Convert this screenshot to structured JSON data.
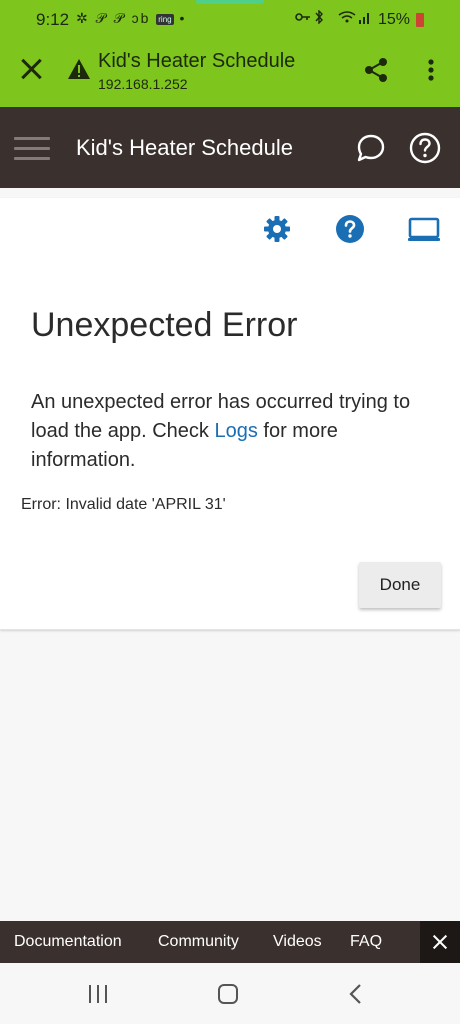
{
  "status_bar": {
    "time": "9:12",
    "notifications": "✲ 𝒫 𝒫 ↄb",
    "ring_badge": "ring",
    "dot": "•",
    "battery": "15%"
  },
  "browser": {
    "title": "Kid's Heater Schedule",
    "url": "192.168.1.252"
  },
  "app": {
    "title": "Kid's Heater Schedule"
  },
  "toolbar_icons": [
    "gear-icon",
    "help-icon",
    "laptop-icon"
  ],
  "error": {
    "title": "Unexpected Error",
    "message_before": "An unexpected error has occurred trying to load the app. Check ",
    "link": "Logs",
    "message_after": " for more information.",
    "detail": "Error: Invalid date 'APRIL 31'",
    "done_label": "Done"
  },
  "bottom_links": [
    "Documentation",
    "Community",
    "Videos",
    "FAQ"
  ],
  "colors": {
    "status_green": "#7ec51e",
    "header_dark": "#3a302d",
    "accent_blue": "#1a6fb4"
  }
}
